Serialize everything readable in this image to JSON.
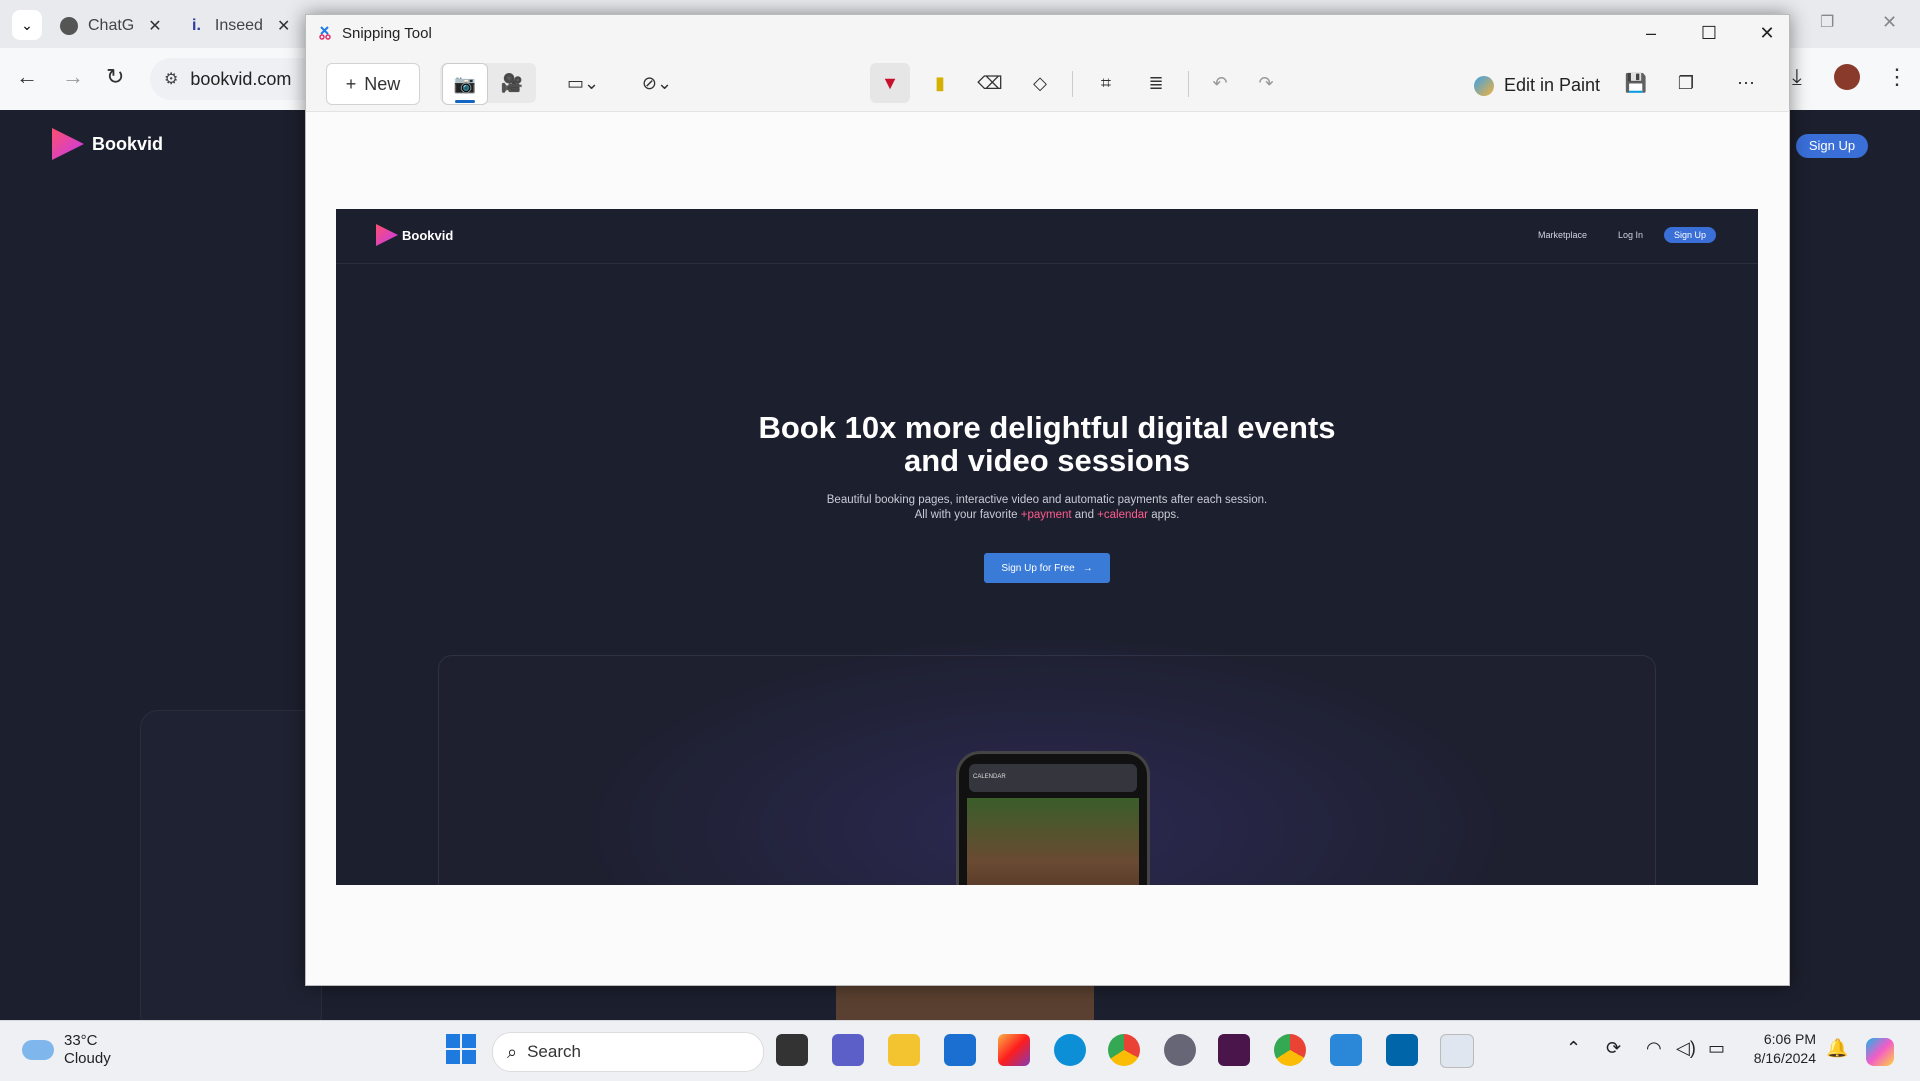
{
  "browser": {
    "tabs": [
      {
        "title": "ChatG",
        "icon": "chatgpt-icon"
      },
      {
        "title": "Inseed",
        "icon": "indeed-icon"
      }
    ],
    "url": "bookvid.com"
  },
  "bg_page": {
    "brand": "Bookvid",
    "signup": "Sign Up"
  },
  "snipping_tool": {
    "title": "Snipping Tool",
    "new_label": "New",
    "edit_in_paint": "Edit in Paint",
    "tools": [
      "screenshot-mode-icon",
      "video-mode-icon",
      "rectangle-snip-icon",
      "delay-timer-icon",
      "ballpoint-pen-icon",
      "highlighter-icon",
      "eraser-icon",
      "shapes-icon",
      "crop-icon",
      "text-actions-icon",
      "undo-icon",
      "redo-icon",
      "save-icon",
      "copy-icon",
      "more-icon"
    ]
  },
  "captured": {
    "brand": "Bookvid",
    "nav": {
      "marketplace": "Marketplace",
      "login": "Log In",
      "signup": "Sign Up"
    },
    "hero_title_1": "Book 10x more delightful digital events",
    "hero_title_2": "and video sessions",
    "hero_sub_1": "Beautiful booking pages, interactive video and automatic payments after each session.",
    "hero_sub_2a": "All with your favorite",
    "hero_sub_payment": "+payment",
    "hero_sub_and": "and",
    "hero_sub_calendar": "+calendar",
    "hero_sub_2b": "apps.",
    "cta": "Sign Up for Free",
    "phone_label": "CALENDAR"
  },
  "taskbar": {
    "temp": "33°C",
    "condition": "Cloudy",
    "search": "Search",
    "time": "6:06 PM",
    "date": "8/16/2024"
  },
  "colors": {
    "accent": "#3a7bd8",
    "brand_pink": "#ff5d8f",
    "page_bg": "#1c1f2d"
  }
}
